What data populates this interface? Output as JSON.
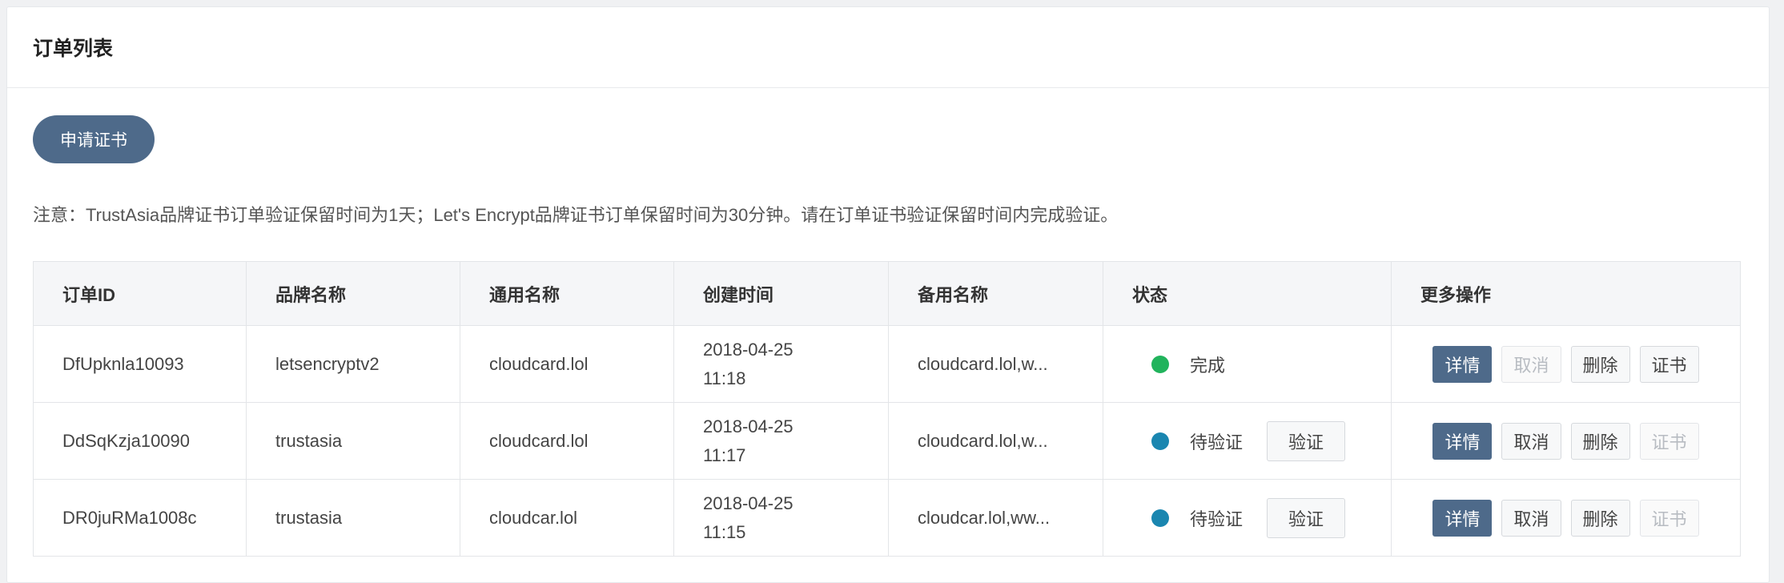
{
  "panel": {
    "title": "订单列表"
  },
  "toolbar": {
    "apply_label": "申请证书"
  },
  "notice": "注意：TrustAsia品牌证书订单验证保留时间为1天；Let's Encrypt品牌证书订单保留时间为30分钟。请在订单证书验证保留时间内完成验证。",
  "table": {
    "headers": [
      "订单ID",
      "品牌名称",
      "通用名称",
      "创建时间",
      "备用名称",
      "状态",
      "更多操作"
    ],
    "rows": [
      {
        "id": "DfUpknla10093",
        "brand": "letsencryptv2",
        "common_name": "cloudcard.lol",
        "date": "2018-04-25",
        "time": "11:18",
        "alt_names": "cloudcard.lol,w...",
        "status": "完成",
        "status_color": "#21b35c",
        "show_verify": false,
        "verify_label": "验证",
        "ops": {
          "detail": "详情",
          "cancel": "取消",
          "delete": "删除",
          "cert": "证书"
        },
        "cancel_enabled": false,
        "cert_enabled": true
      },
      {
        "id": "DdSqKzja10090",
        "brand": "trustasia",
        "common_name": "cloudcard.lol",
        "date": "2018-04-25",
        "time": "11:17",
        "alt_names": "cloudcard.lol,w...",
        "status": "待验证",
        "status_color": "#1a86b0",
        "show_verify": true,
        "verify_label": "验证",
        "ops": {
          "detail": "详情",
          "cancel": "取消",
          "delete": "删除",
          "cert": "证书"
        },
        "cancel_enabled": true,
        "cert_enabled": false
      },
      {
        "id": "DR0juRMa1008c",
        "brand": "trustasia",
        "common_name": "cloudcar.lol",
        "date": "2018-04-25",
        "time": "11:15",
        "alt_names": "cloudcar.lol,ww...",
        "status": "待验证",
        "status_color": "#1a86b0",
        "show_verify": true,
        "verify_label": "验证",
        "ops": {
          "detail": "详情",
          "cancel": "取消",
          "delete": "删除",
          "cert": "证书"
        },
        "cancel_enabled": true,
        "cert_enabled": false
      }
    ]
  }
}
